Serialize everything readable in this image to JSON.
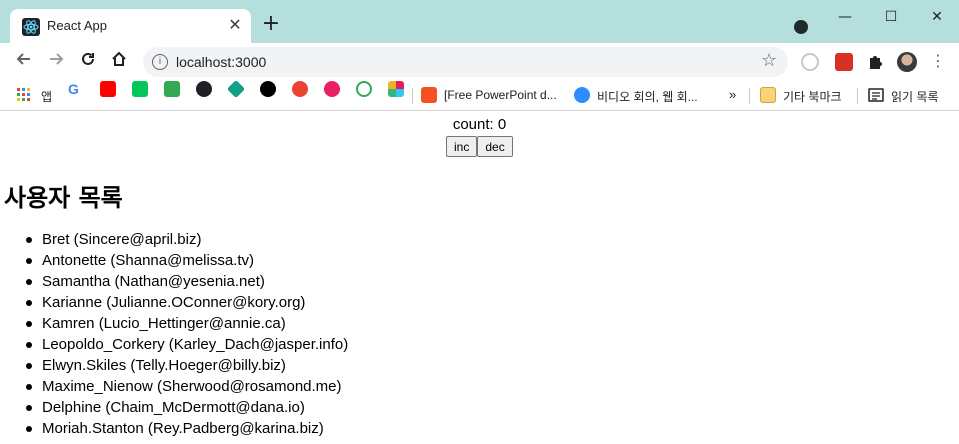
{
  "browser": {
    "tab_title": "React App",
    "tab_close": "✕",
    "new_tab": "+",
    "window_controls": {
      "minimize": "—",
      "maximize": "☐",
      "close": "✕"
    },
    "url": "localhost:3000",
    "info_icon": "i",
    "star_icon": "☆",
    "menu_icon": "⋮",
    "bookmarks": {
      "apps_label": "앱",
      "bm1_label": "[Free PowerPoint d...",
      "bm2_label": "비디오 회의, 웹 회...",
      "more": "»",
      "folder_label": "기타 북마크",
      "reading_label": "읽기 목록"
    }
  },
  "page": {
    "count_text": "count: 0",
    "inc_label": "inc",
    "dec_label": "dec",
    "heading": "사용자 목록",
    "users": [
      "Bret (Sincere@april.biz)",
      "Antonette (Shanna@melissa.tv)",
      "Samantha (Nathan@yesenia.net)",
      "Karianne (Julianne.OConner@kory.org)",
      "Kamren (Lucio_Hettinger@annie.ca)",
      "Leopoldo_Corkery (Karley_Dach@jasper.info)",
      "Elwyn.Skiles (Telly.Hoeger@billy.biz)",
      "Maxime_Nienow (Sherwood@rosamond.me)",
      "Delphine (Chaim_McDermott@dana.io)",
      "Moriah.Stanton (Rey.Padberg@karina.biz)"
    ]
  },
  "colors": {
    "tabstrip": "#b5dfdd",
    "omnibox": "#f1f3f4"
  }
}
